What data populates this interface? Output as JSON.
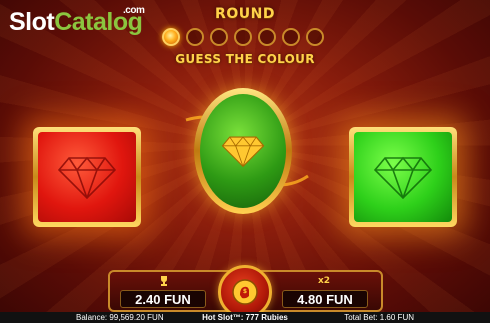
{
  "logo": {
    "part1": "Slot",
    "part2": "Catalog",
    "suffix": ".com"
  },
  "round": {
    "label": "ROUND",
    "total": 7,
    "current": 1
  },
  "instruction": "GUESS THE COLOUR",
  "cards": [
    {
      "id": "red",
      "color": "#e0160e"
    },
    {
      "id": "green",
      "color": "#2ed01a"
    }
  ],
  "center_card": {
    "color": "#2e9a14"
  },
  "win_panel": {
    "current_win": "2.40 FUN",
    "multiplier_label": "x2",
    "next_win": "4.80 FUN"
  },
  "status_bar": {
    "balance": "Balance: 99,569.20 FUN",
    "game": "Hot Slot™: 777 Rubies",
    "total_bet": "Total Bet: 1.60 FUN"
  }
}
